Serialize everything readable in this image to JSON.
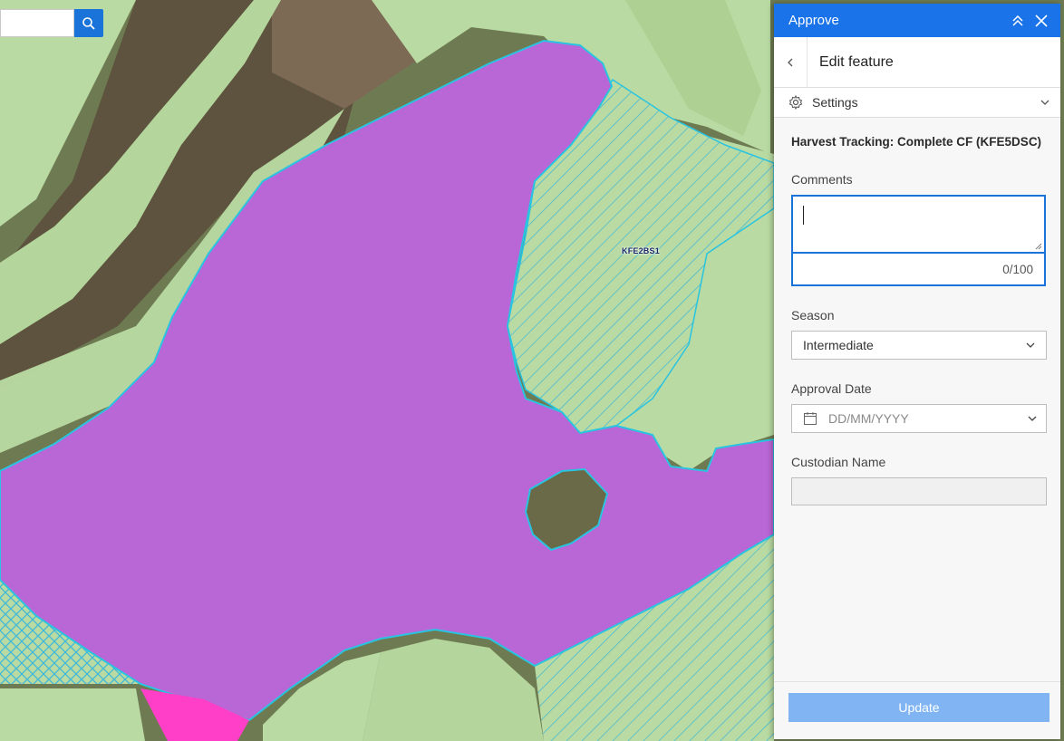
{
  "map": {
    "feature_label": "KFE2BS1"
  },
  "search": {
    "placeholder": "",
    "icon": "search-icon"
  },
  "panel": {
    "title": "Approve",
    "subtitle": "Edit feature",
    "settings_label": "Settings",
    "form_title": "Harvest Tracking: Complete CF (KFE5DSC)",
    "fields": {
      "comments": {
        "label": "Comments",
        "value": "",
        "counter": "0/100"
      },
      "season": {
        "label": "Season",
        "value": "Intermediate"
      },
      "approval_date": {
        "label": "Approval Date",
        "placeholder": "DD/MM/YYYY"
      },
      "custodian": {
        "label": "Custodian Name",
        "value": ""
      }
    },
    "update_label": "Update"
  },
  "colors": {
    "header_blue": "#1a73e8",
    "polygon_purple": "#b966d6",
    "polygon_outline": "#29c4e0",
    "pink": "#ff3fc8",
    "update_disabled": "#80b4f2"
  }
}
